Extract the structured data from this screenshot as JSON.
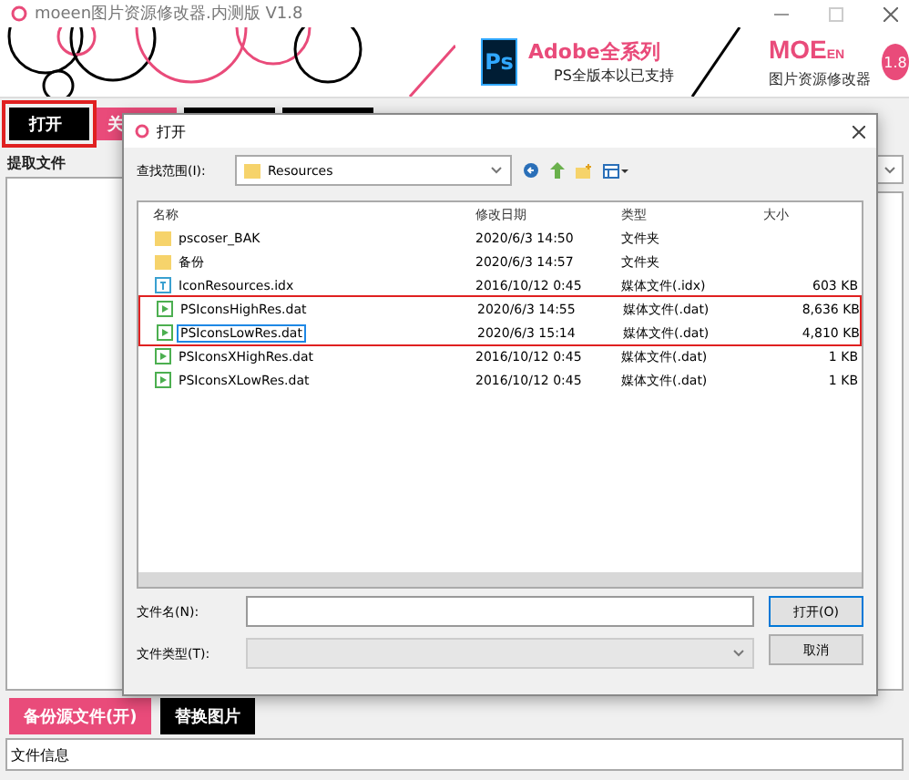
{
  "window": {
    "title": "moeen图片资源修改器.内测版 V1.8"
  },
  "banner": {
    "ps_logo": "Ps",
    "headline": "Adobe全系列",
    "subline": "PS全版本以已支持",
    "brand": "MOE",
    "brand_suffix": "EN",
    "product": "图片资源修改器",
    "version": "1.8"
  },
  "toolbar": [
    {
      "label": "打开",
      "kind": "black",
      "highlighted": true
    },
    {
      "label": "关",
      "kind": "pink",
      "highlighted": false
    },
    {
      "kind": "black",
      "highlighted": false
    },
    {
      "kind": "black",
      "highlighted": false
    }
  ],
  "extract_label": "提取文件",
  "dialog": {
    "title": "打开",
    "look_in_label": "查找范围(I):",
    "folder": "Resources",
    "columns": [
      "名称",
      "修改日期",
      "类型",
      "大小"
    ],
    "files": [
      {
        "name": "pscoser_BAK",
        "date": "2020/6/3 14:50",
        "type": "文件夹",
        "kind": "folder",
        "highlighted": false,
        "outlined": false
      },
      {
        "name": "备份",
        "date": "2020/6/3 14:57",
        "type": "文件夹",
        "kind": "folder",
        "highlighted": false,
        "outlined": false
      },
      {
        "name": "IconResources.idx",
        "date": "2016/10/12 0:45",
        "type": "媒体文件(.idx)",
        "size": "603 KB",
        "kind": "index",
        "highlighted": false,
        "outlined": false
      },
      {
        "name": "PSIconsHighRes.dat",
        "date": "2020/6/3 14:55",
        "type": "媒体文件(.dat)",
        "size": "8,636 KB",
        "kind": "media",
        "highlighted": true,
        "outlined": false
      },
      {
        "name": "PSIconsLowRes.dat",
        "date": "2020/6/3 15:14",
        "type": "媒体文件(.dat)",
        "size": "4,810 KB",
        "kind": "media",
        "highlighted": true,
        "outlined": true
      },
      {
        "name": "PSIconsXHighRes.dat",
        "date": "2016/10/12 0:45",
        "type": "媒体文件(.dat)",
        "size": "1 KB",
        "kind": "media",
        "highlighted": false,
        "outlined": false
      },
      {
        "name": "PSIconsXLowRes.dat",
        "date": "2016/10/12 0:45",
        "type": "媒体文件(.dat)",
        "size": "1 KB",
        "kind": "media",
        "highlighted": false,
        "outlined": false
      }
    ],
    "filename_label": "文件名(N):",
    "filetype_label": "文件类型(T):",
    "open_button": "打开(O)",
    "cancel_button": "取消"
  },
  "actions": [
    {
      "label": "备份源文件(开)",
      "kind": "pink"
    },
    {
      "label": "替换图片",
      "kind": "black"
    }
  ],
  "file_info": "文件信息"
}
